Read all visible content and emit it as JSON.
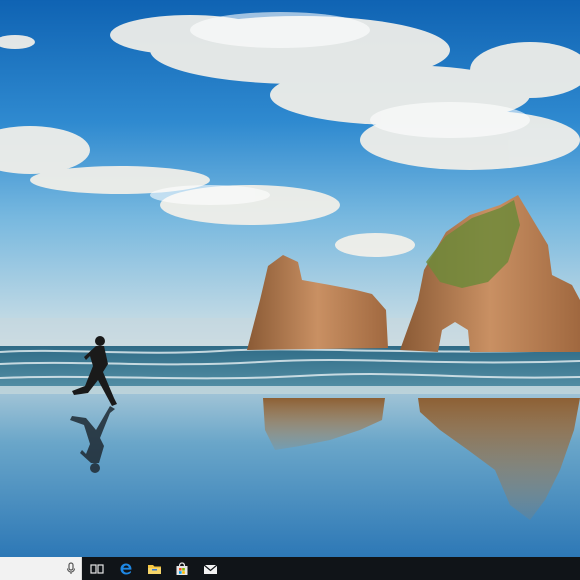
{
  "desktop": {
    "wallpaper": "beach-with-rock-arches-and-runner",
    "colors": {
      "sky_top": "#1669b8",
      "sky_mid": "#3f9ad8",
      "horizon": "#c9dde6",
      "sea": "#3c7c98",
      "sand_reflection": "#5da0c4",
      "rock": "#b57a4c",
      "moss": "#6f8a3a"
    }
  },
  "taskbar": {
    "background": "#101418",
    "search": {
      "value": "",
      "placeholder": "",
      "icon": "microphone-icon"
    },
    "items": [
      {
        "name": "task-view",
        "icon": "task-view-icon"
      },
      {
        "name": "edge",
        "icon": "edge-icon",
        "color": "#1e88e5"
      },
      {
        "name": "file-explorer",
        "icon": "folder-icon",
        "color": "#f4c542"
      },
      {
        "name": "store",
        "icon": "store-bag-icon"
      },
      {
        "name": "mail",
        "icon": "mail-envelope-icon"
      }
    ]
  }
}
